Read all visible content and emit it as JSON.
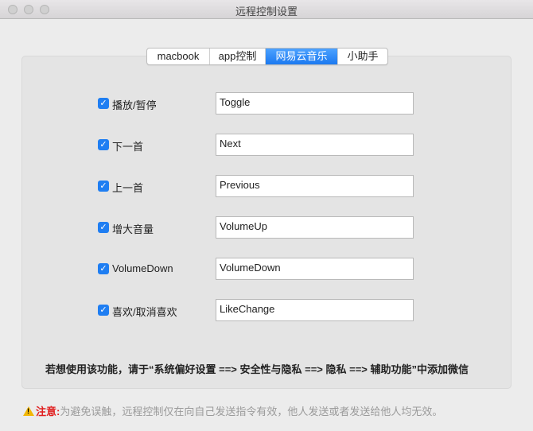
{
  "window": {
    "title": "远程控制设置"
  },
  "tabs": [
    {
      "label": "macbook",
      "active": false
    },
    {
      "label": "app控制",
      "active": false
    },
    {
      "label": "网易云音乐",
      "active": true
    },
    {
      "label": "小助手",
      "active": false
    }
  ],
  "rows": [
    {
      "label": "播放/暂停",
      "checked": true,
      "value": "Toggle"
    },
    {
      "label": "下一首",
      "checked": true,
      "value": "Next"
    },
    {
      "label": "上一首",
      "checked": true,
      "value": "Previous"
    },
    {
      "label": "增大音量",
      "checked": true,
      "value": "VolumeUp"
    },
    {
      "label": "VolumeDown",
      "checked": true,
      "value": "VolumeDown"
    },
    {
      "label": "喜欢/取消喜欢",
      "checked": true,
      "value": "LikeChange"
    }
  ],
  "notice": "若想使用该功能，请于“系统偏好设置 ==> 安全性与隐私 ==> 隐私 ==> 辅助功能”中添加微信",
  "warning": {
    "label": "注意:",
    "text": "为避免误触，远程控制仅在向自己发送指令有效，他人发送或者发送给他人均无效。"
  },
  "colors": {
    "accent": "#1f7ef2",
    "warning_label": "#e02020"
  }
}
